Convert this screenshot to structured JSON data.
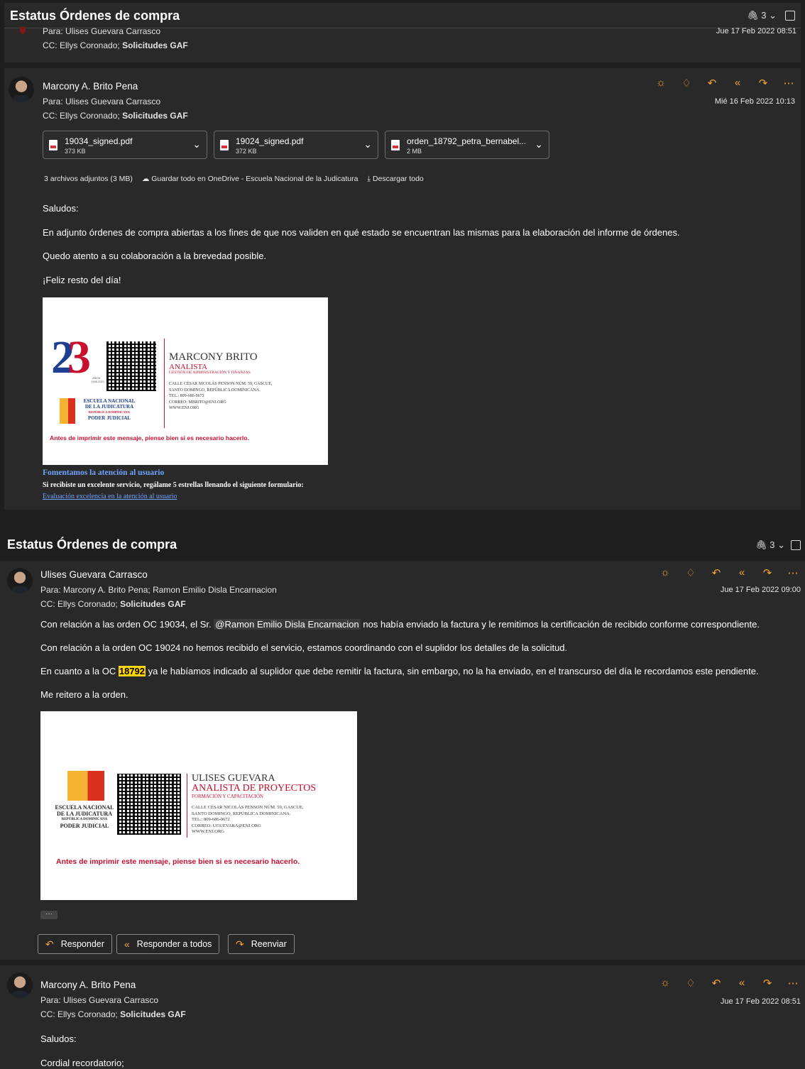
{
  "thread1": {
    "subject": "Estatus Órdenes de compra",
    "attach_count": "3",
    "prev_to": "Para: Ulises Guevara Carrasco",
    "prev_date": "Jue 17 Feb 2022 08:51",
    "prev_cc_label": "CC: Ellys Coronado;",
    "prev_cc_bold": "Solicitudes GAF"
  },
  "msg1": {
    "sender": "Marcony A. Brito Pena",
    "to": "Para: Ulises Guevara Carrasco",
    "cc_label": "CC: Ellys Coronado;",
    "cc_bold": "Solicitudes GAF",
    "date": "Mié 16 Feb 2022 10:13",
    "attachments": [
      {
        "name": "19034_signed.pdf",
        "size": "373 KB"
      },
      {
        "name": "19024_signed.pdf",
        "size": "372 KB"
      },
      {
        "name": "orden_18792_petra_bernabel...",
        "size": "2 MB"
      }
    ],
    "attach_summary": "3 archivos adjuntos (3 MB)",
    "save_onedrive": "Guardar todo en OneDrive - Escuela Nacional de la Judicatura",
    "download_all": "Descargar todo",
    "greeting": "Saludos:",
    "p1": "En adjunto órdenes de compra abiertas a los fines de que nos validen en qué estado se encuentran las mismas para la elaboración del informe de órdenes.",
    "p2": "Quedo atento a su colaboración a la brevedad posible.",
    "p3": "¡Feliz resto del día!",
    "card": {
      "anos": "AÑOS",
      "years": "1998-2021",
      "name": "MARCONY BRITO",
      "role": "ANALISTA",
      "dept": "GESTIÓN DE ADMINISTRACIÓN Y FINANZAS",
      "addr1": "CALLE CÉSAR NICOLÁS PENSON NÚM. 59, GASCUE,",
      "addr2": "SANTO DOMINGO, REPÚBLICA DOMINICANA.",
      "tel": "TEL.: 809-686-0672",
      "mail": "CORREO: MBRITO@ENJ.ORG",
      "web": "WWW.ENJ.ORG",
      "org1": "ESCUELA NACIONAL",
      "org2": "DE LA JUDICATURA",
      "org3": "REPÚBLICA DOMINICANA",
      "org4": "PODER JUDICIAL",
      "warning": "Antes de imprimir este mensaje, piense bien si es necesario hacerlo."
    },
    "promo_title": "Fomentamos la atención al usuario",
    "promo_text": "Si recibiste un excelente servicio, regálame 5 estrellas llenando el siguiente formulario:",
    "promo_link": "Evaluación excelencia en la atención al usuario"
  },
  "thread2": {
    "subject": "Estatus Órdenes de compra",
    "attach_count": "3"
  },
  "msg2": {
    "sender": "Ulises Guevara Carrasco",
    "to": "Para: Marcony A. Brito Pena;  Ramon Emilio Disla Encarnacion",
    "cc_label": "CC: Ellys Coronado;",
    "cc_bold": "Solicitudes GAF",
    "date": "Jue 17 Feb 2022 09:00",
    "l1a": "Con relación a las orden OC 19034, el Sr.",
    "l1m": "@Ramon Emilio Disla Encarnacion",
    "l1b": "nos había enviado la factura y le remitimos la certificación de recibido conforme correspondiente.",
    "l2": "Con relación a la orden OC 19024 no hemos recibido el servicio, estamos coordinando con el suplidor los detalles de la solicitud.",
    "l3a": "En cuanto a la OC",
    "l3h": "18792",
    "l3b": "ya le habíamos indicado al suplidor que debe remitir la factura, sin embargo, no la ha enviado, en el transcurso del día le recordamos este pendiente.",
    "l4": "Me reitero a la orden.",
    "card": {
      "name": "ULISES GUEVARA",
      "role": "ANALISTA DE PROYECTOS",
      "dept": "FORMACIÓN Y CAPACITACIÓN",
      "addr1": "CALLE CÉSAR NICOLÁS PENSON NÚM. 59, GASCUE,",
      "addr2": "SANTO DOMINGO, REPÚBLICA DOMINICANA.",
      "tel": "TEL.: 809-686-0672",
      "mail": "CORREO: UGUEVARA@ENJ.ORG",
      "web": "WWW.ENJ.ORG",
      "org1": "ESCUELA NACIONAL",
      "org2": "DE LA JUDICATURA",
      "org3": "REPÚBLICA DOMINICANA",
      "org4": "PODER JUDICIAL",
      "warning": "Antes de imprimir este mensaje, piense bien si es necesario hacerlo."
    },
    "more": "···",
    "reply": "Responder",
    "reply_all": "Responder a todos",
    "forward": "Reenviar"
  },
  "msg3": {
    "sender": "Marcony A. Brito Pena",
    "to": "Para: Ulises Guevara Carrasco",
    "cc_label": "CC: Ellys Coronado;",
    "cc_bold": "Solicitudes GAF",
    "date": "Jue 17 Feb 2022 08:51",
    "greeting": "Saludos:",
    "p1": "Cordial recordatorio;"
  },
  "icons": {
    "attach": "paperclip-icon",
    "brightness": "sun-icon",
    "like": "thumbs-up-icon",
    "reply": "reply-icon",
    "reply_all": "reply-all-icon",
    "forward": "forward-icon",
    "more": "more-icon"
  },
  "colors": {
    "accent": "#f0a23a",
    "highlight": "#ffd400",
    "link": "#6ea3ff",
    "brand_red": "#c8102e"
  }
}
